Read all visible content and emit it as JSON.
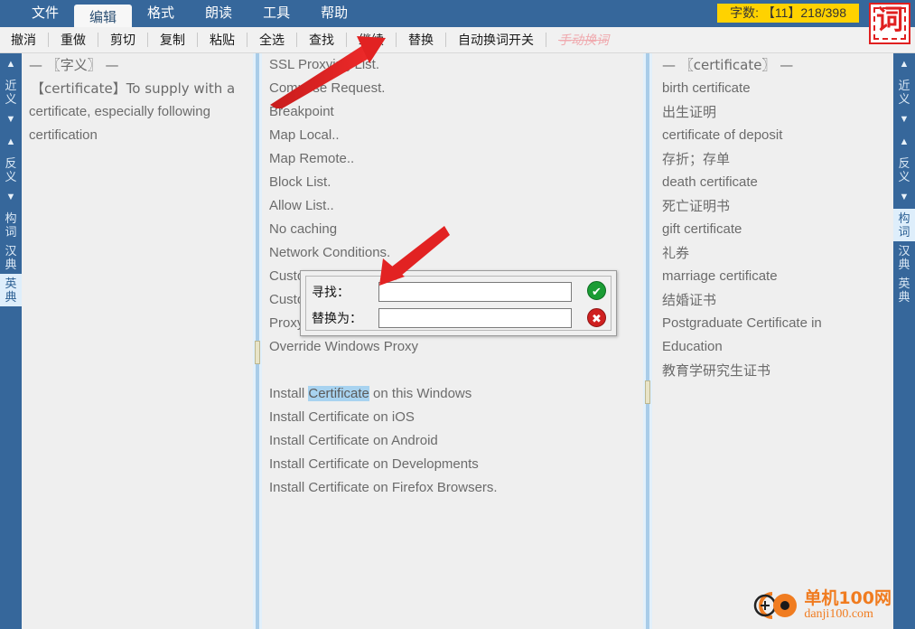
{
  "menu": {
    "tabs": [
      {
        "label": "文件",
        "active": false
      },
      {
        "label": "编辑",
        "active": true
      },
      {
        "label": "格式",
        "active": false
      },
      {
        "label": "朗读",
        "active": false
      },
      {
        "label": "工具",
        "active": false
      },
      {
        "label": "帮助",
        "active": false
      }
    ],
    "word_count": "字数: 【11】218/398",
    "seal_glyph": "词",
    "bar_color": "#36679b",
    "badge_color": "#ffd200"
  },
  "toolbar": {
    "items": [
      {
        "label": "撤消",
        "disabled": false
      },
      {
        "label": "重做",
        "disabled": false
      },
      {
        "label": "剪切",
        "disabled": false
      },
      {
        "label": "复制",
        "disabled": false
      },
      {
        "label": "粘贴",
        "disabled": false
      },
      {
        "label": "全选",
        "disabled": false
      },
      {
        "label": "查找",
        "disabled": false
      },
      {
        "label": "继续",
        "disabled": false
      },
      {
        "label": "替换",
        "disabled": false
      },
      {
        "label": "自动换词开关",
        "disabled": false
      },
      {
        "label": "手动换词",
        "disabled": true
      }
    ]
  },
  "rail_left": {
    "items": [
      {
        "label": "▲",
        "kind": "arrow",
        "selected": false
      },
      {
        "label": "近义",
        "kind": "text",
        "selected": false
      },
      {
        "label": "▼",
        "kind": "arrow",
        "selected": false
      },
      {
        "label": "▲",
        "kind": "arrow",
        "selected": false
      },
      {
        "label": "反义",
        "kind": "text",
        "selected": false
      },
      {
        "label": "▼",
        "kind": "arrow",
        "selected": false
      },
      {
        "label": "构词",
        "kind": "text",
        "selected": false
      },
      {
        "label": "汉典",
        "kind": "text",
        "selected": false
      },
      {
        "label": "英典",
        "kind": "text",
        "selected": true
      }
    ]
  },
  "rail_right": {
    "items": [
      {
        "label": "▲",
        "kind": "arrow",
        "selected": false
      },
      {
        "label": "近义",
        "kind": "text",
        "selected": false
      },
      {
        "label": "▼",
        "kind": "arrow",
        "selected": false
      },
      {
        "label": "▲",
        "kind": "arrow",
        "selected": false
      },
      {
        "label": "反义",
        "kind": "text",
        "selected": false
      },
      {
        "label": "▼",
        "kind": "arrow",
        "selected": false
      },
      {
        "label": "构词",
        "kind": "text",
        "selected": true
      },
      {
        "label": "汉典",
        "kind": "text",
        "selected": false
      },
      {
        "label": "英典",
        "kind": "text",
        "selected": false
      }
    ]
  },
  "panel_left": {
    "lines": [
      {
        "text": "— 〖字义〗 —",
        "indent": false
      },
      {
        "text": "【certificate】To supply with a",
        "indent": true
      },
      {
        "text": "certificate, especially following",
        "indent": false
      },
      {
        "text": "certification",
        "indent": false
      }
    ]
  },
  "panel_mid": {
    "lines": [
      {
        "text": "SSL Proxying List."
      },
      {
        "text": "Compose Request."
      },
      {
        "text": "Breakpoint"
      },
      {
        "text": "Map Local.."
      },
      {
        "text": "Map Remote.."
      },
      {
        "text": "Block List."
      },
      {
        "text": "Allow List.."
      },
      {
        "text": "No caching"
      },
      {
        "text": "Network Conditions."
      },
      {
        "text": "Custom Headers"
      },
      {
        "text": "Custom Rewrite"
      },
      {
        "text": "Proxy Settings"
      },
      {
        "text": "Override Windows Proxy"
      },
      {
        "text": ""
      },
      {
        "text": "Install Certificate on this Windows",
        "highlight": "Certificate"
      },
      {
        "text": "Install Certificate on iOS"
      },
      {
        "text": "Install Certificate on Android"
      },
      {
        "text": "Install Certificate on Developments"
      },
      {
        "text": "Install Certificate on Firefox Browsers."
      }
    ]
  },
  "panel_right": {
    "lines": [
      {
        "text": "— 〖certificate〗 —"
      },
      {
        "text": "birth certificate"
      },
      {
        "text": "出生证明"
      },
      {
        "text": "certificate of deposit"
      },
      {
        "text": "存折；存单"
      },
      {
        "text": "death certificate"
      },
      {
        "text": "死亡证明书"
      },
      {
        "text": "gift certificate"
      },
      {
        "text": "礼券"
      },
      {
        "text": "marriage certificate"
      },
      {
        "text": "结婚证书"
      },
      {
        "text": "Postgraduate Certificate in"
      },
      {
        "text": "Education"
      },
      {
        "text": "教育学研究生证书"
      }
    ]
  },
  "dialog": {
    "find_label": "寻找：",
    "find_value": "",
    "replace_label": "替换为：",
    "replace_value": "",
    "confirm_glyph": "✔",
    "cancel_glyph": "✖"
  },
  "watermark": {
    "line1": "单机100网",
    "line2": "danji100.com",
    "color": "#f07c20"
  }
}
